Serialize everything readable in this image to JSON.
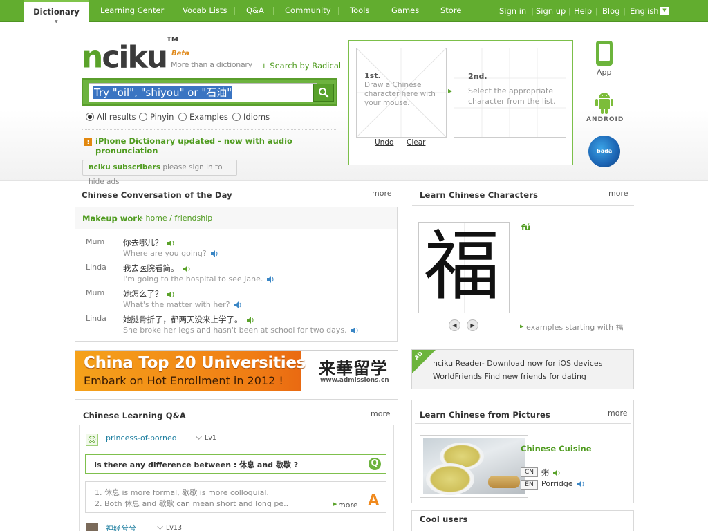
{
  "nav": {
    "tabs": [
      "Dictionary",
      "Learning Center",
      "Vocab Lists",
      "Q&A",
      "Community",
      "Tools",
      "Games",
      "Store"
    ],
    "right_links": [
      "Sign in",
      "Sign up",
      "Help",
      "Blog",
      "English"
    ]
  },
  "header": {
    "logo": "nciku",
    "logo_tm": "TM",
    "beta": "Beta",
    "tagline": "More than a dictionary",
    "radical_link": "+ Search by Radical",
    "search_placeholder": "Try \"oil\", \"shiyou\" or \"石油\"",
    "radio_options": [
      "All results",
      "Pinyin",
      "Examples",
      "Idioms"
    ],
    "selected_radio": "All results",
    "alert": "iPhone Dictionary updated - now with audio pronunciation",
    "subscribers_bold": "nciku subscribers",
    "subscribers_rest": " please sign in to hide ads"
  },
  "drawing": {
    "step1_title": "1st.",
    "step1_text": "Draw a Chinese character here with your mouse.",
    "step2_title": "2nd.",
    "step2_text": "Select the appropriate character from the list.",
    "undo": "Undo",
    "clear": "Clear"
  },
  "platforms": {
    "app_label": "App",
    "android_label": "ANDROID"
  },
  "conversation": {
    "title": "Chinese Conversation of the Day",
    "more": "more",
    "topic": "Makeup work",
    "topic_tags": " - home / friendship",
    "lines": [
      {
        "speaker": "Mum",
        "zh": "你去哪儿？",
        "en": "Where are you going?"
      },
      {
        "speaker": "Linda",
        "zh": "我去医院看简。",
        "en": "I'm going to the hospital to see Jane."
      },
      {
        "speaker": "Mum",
        "zh": "她怎么了？",
        "en": "What's the matter with her?"
      },
      {
        "speaker": "Linda",
        "zh": "她腿骨折了，都两天没来上学了。",
        "en": "She broke her legs and hasn't been at school for two days."
      }
    ]
  },
  "banner": {
    "line1": "China Top 20 Universities",
    "line2": "Embark on Hot Enrollment in 2012 !",
    "zh": "来華留学",
    "url": "www.admissions.cn"
  },
  "qa": {
    "title": "Chinese Learning Q&A",
    "more": "more",
    "user": "princess-of-borneo",
    "user_level": "Lv1",
    "question": "Is there any difference between : 休息 and 歇歇 ?",
    "answer1": "1. 休息 is more formal, 歇歇 is more colloquial.",
    "answer2": "2. Both 休息 and 歇歇 can mean short and long pe..",
    "answer_more": "more",
    "user2": "神经兮兮",
    "user2_level": "Lv13"
  },
  "characters": {
    "title": "Learn Chinese Characters",
    "more": "more",
    "character": "福",
    "pinyin": "fú",
    "examples_link": "examples starting with 福"
  },
  "ad": {
    "label": "AD",
    "line1": "nciku Reader- Download now for iOS devices",
    "line2": "WorldFriends Find new friends for dating"
  },
  "pictures": {
    "title": "Learn Chinese from Pictures",
    "more": "more",
    "topic": "Chinese Cuisine",
    "cn_tag": "CN",
    "cn_word": "粥",
    "en_tag": "EN",
    "en_word": "Porridge"
  },
  "cool_users": {
    "title": "Cool users"
  },
  "colors": {
    "brand_green": "#62ad2f",
    "link_green": "#4f9b1f",
    "orange": "#f08a1e"
  }
}
